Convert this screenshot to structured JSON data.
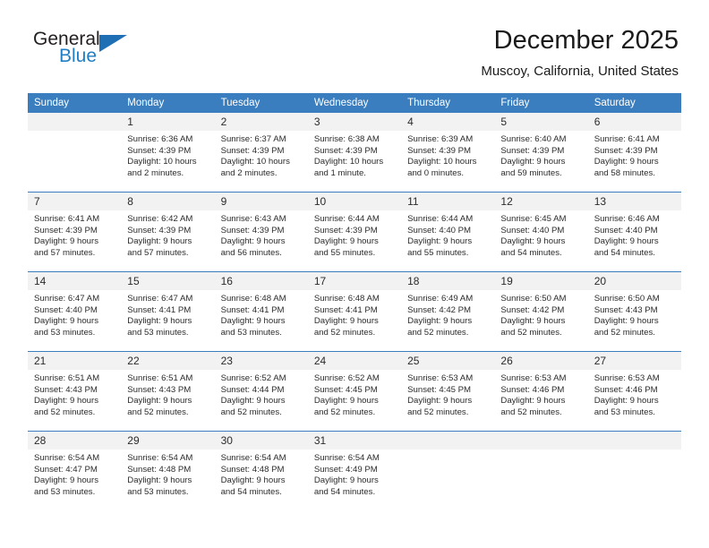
{
  "brand": {
    "name_part1": "General",
    "name_part2": "Blue",
    "triangle_color": "#1f6fb5",
    "blue_color": "#1f7ec4"
  },
  "header": {
    "title": "December 2025",
    "subtitle": "Muscoy, California, United States"
  },
  "theme": {
    "header_bar_color": "#3a7ebf",
    "daynum_background": "#f2f2f2",
    "row_divider_color": "#3a7ebf"
  },
  "weekdays": [
    "Sunday",
    "Monday",
    "Tuesday",
    "Wednesday",
    "Thursday",
    "Friday",
    "Saturday"
  ],
  "weeks": [
    [
      {
        "day": "",
        "lines": []
      },
      {
        "day": "1",
        "lines": [
          "Sunrise: 6:36 AM",
          "Sunset: 4:39 PM",
          "Daylight: 10 hours",
          "and 2 minutes."
        ]
      },
      {
        "day": "2",
        "lines": [
          "Sunrise: 6:37 AM",
          "Sunset: 4:39 PM",
          "Daylight: 10 hours",
          "and 2 minutes."
        ]
      },
      {
        "day": "3",
        "lines": [
          "Sunrise: 6:38 AM",
          "Sunset: 4:39 PM",
          "Daylight: 10 hours",
          "and 1 minute."
        ]
      },
      {
        "day": "4",
        "lines": [
          "Sunrise: 6:39 AM",
          "Sunset: 4:39 PM",
          "Daylight: 10 hours",
          "and 0 minutes."
        ]
      },
      {
        "day": "5",
        "lines": [
          "Sunrise: 6:40 AM",
          "Sunset: 4:39 PM",
          "Daylight: 9 hours",
          "and 59 minutes."
        ]
      },
      {
        "day": "6",
        "lines": [
          "Sunrise: 6:41 AM",
          "Sunset: 4:39 PM",
          "Daylight: 9 hours",
          "and 58 minutes."
        ]
      }
    ],
    [
      {
        "day": "7",
        "lines": [
          "Sunrise: 6:41 AM",
          "Sunset: 4:39 PM",
          "Daylight: 9 hours",
          "and 57 minutes."
        ]
      },
      {
        "day": "8",
        "lines": [
          "Sunrise: 6:42 AM",
          "Sunset: 4:39 PM",
          "Daylight: 9 hours",
          "and 57 minutes."
        ]
      },
      {
        "day": "9",
        "lines": [
          "Sunrise: 6:43 AM",
          "Sunset: 4:39 PM",
          "Daylight: 9 hours",
          "and 56 minutes."
        ]
      },
      {
        "day": "10",
        "lines": [
          "Sunrise: 6:44 AM",
          "Sunset: 4:39 PM",
          "Daylight: 9 hours",
          "and 55 minutes."
        ]
      },
      {
        "day": "11",
        "lines": [
          "Sunrise: 6:44 AM",
          "Sunset: 4:40 PM",
          "Daylight: 9 hours",
          "and 55 minutes."
        ]
      },
      {
        "day": "12",
        "lines": [
          "Sunrise: 6:45 AM",
          "Sunset: 4:40 PM",
          "Daylight: 9 hours",
          "and 54 minutes."
        ]
      },
      {
        "day": "13",
        "lines": [
          "Sunrise: 6:46 AM",
          "Sunset: 4:40 PM",
          "Daylight: 9 hours",
          "and 54 minutes."
        ]
      }
    ],
    [
      {
        "day": "14",
        "lines": [
          "Sunrise: 6:47 AM",
          "Sunset: 4:40 PM",
          "Daylight: 9 hours",
          "and 53 minutes."
        ]
      },
      {
        "day": "15",
        "lines": [
          "Sunrise: 6:47 AM",
          "Sunset: 4:41 PM",
          "Daylight: 9 hours",
          "and 53 minutes."
        ]
      },
      {
        "day": "16",
        "lines": [
          "Sunrise: 6:48 AM",
          "Sunset: 4:41 PM",
          "Daylight: 9 hours",
          "and 53 minutes."
        ]
      },
      {
        "day": "17",
        "lines": [
          "Sunrise: 6:48 AM",
          "Sunset: 4:41 PM",
          "Daylight: 9 hours",
          "and 52 minutes."
        ]
      },
      {
        "day": "18",
        "lines": [
          "Sunrise: 6:49 AM",
          "Sunset: 4:42 PM",
          "Daylight: 9 hours",
          "and 52 minutes."
        ]
      },
      {
        "day": "19",
        "lines": [
          "Sunrise: 6:50 AM",
          "Sunset: 4:42 PM",
          "Daylight: 9 hours",
          "and 52 minutes."
        ]
      },
      {
        "day": "20",
        "lines": [
          "Sunrise: 6:50 AM",
          "Sunset: 4:43 PM",
          "Daylight: 9 hours",
          "and 52 minutes."
        ]
      }
    ],
    [
      {
        "day": "21",
        "lines": [
          "Sunrise: 6:51 AM",
          "Sunset: 4:43 PM",
          "Daylight: 9 hours",
          "and 52 minutes."
        ]
      },
      {
        "day": "22",
        "lines": [
          "Sunrise: 6:51 AM",
          "Sunset: 4:43 PM",
          "Daylight: 9 hours",
          "and 52 minutes."
        ]
      },
      {
        "day": "23",
        "lines": [
          "Sunrise: 6:52 AM",
          "Sunset: 4:44 PM",
          "Daylight: 9 hours",
          "and 52 minutes."
        ]
      },
      {
        "day": "24",
        "lines": [
          "Sunrise: 6:52 AM",
          "Sunset: 4:45 PM",
          "Daylight: 9 hours",
          "and 52 minutes."
        ]
      },
      {
        "day": "25",
        "lines": [
          "Sunrise: 6:53 AM",
          "Sunset: 4:45 PM",
          "Daylight: 9 hours",
          "and 52 minutes."
        ]
      },
      {
        "day": "26",
        "lines": [
          "Sunrise: 6:53 AM",
          "Sunset: 4:46 PM",
          "Daylight: 9 hours",
          "and 52 minutes."
        ]
      },
      {
        "day": "27",
        "lines": [
          "Sunrise: 6:53 AM",
          "Sunset: 4:46 PM",
          "Daylight: 9 hours",
          "and 53 minutes."
        ]
      }
    ],
    [
      {
        "day": "28",
        "lines": [
          "Sunrise: 6:54 AM",
          "Sunset: 4:47 PM",
          "Daylight: 9 hours",
          "and 53 minutes."
        ]
      },
      {
        "day": "29",
        "lines": [
          "Sunrise: 6:54 AM",
          "Sunset: 4:48 PM",
          "Daylight: 9 hours",
          "and 53 minutes."
        ]
      },
      {
        "day": "30",
        "lines": [
          "Sunrise: 6:54 AM",
          "Sunset: 4:48 PM",
          "Daylight: 9 hours",
          "and 54 minutes."
        ]
      },
      {
        "day": "31",
        "lines": [
          "Sunrise: 6:54 AM",
          "Sunset: 4:49 PM",
          "Daylight: 9 hours",
          "and 54 minutes."
        ]
      },
      {
        "day": "",
        "lines": []
      },
      {
        "day": "",
        "lines": []
      },
      {
        "day": "",
        "lines": []
      }
    ]
  ]
}
